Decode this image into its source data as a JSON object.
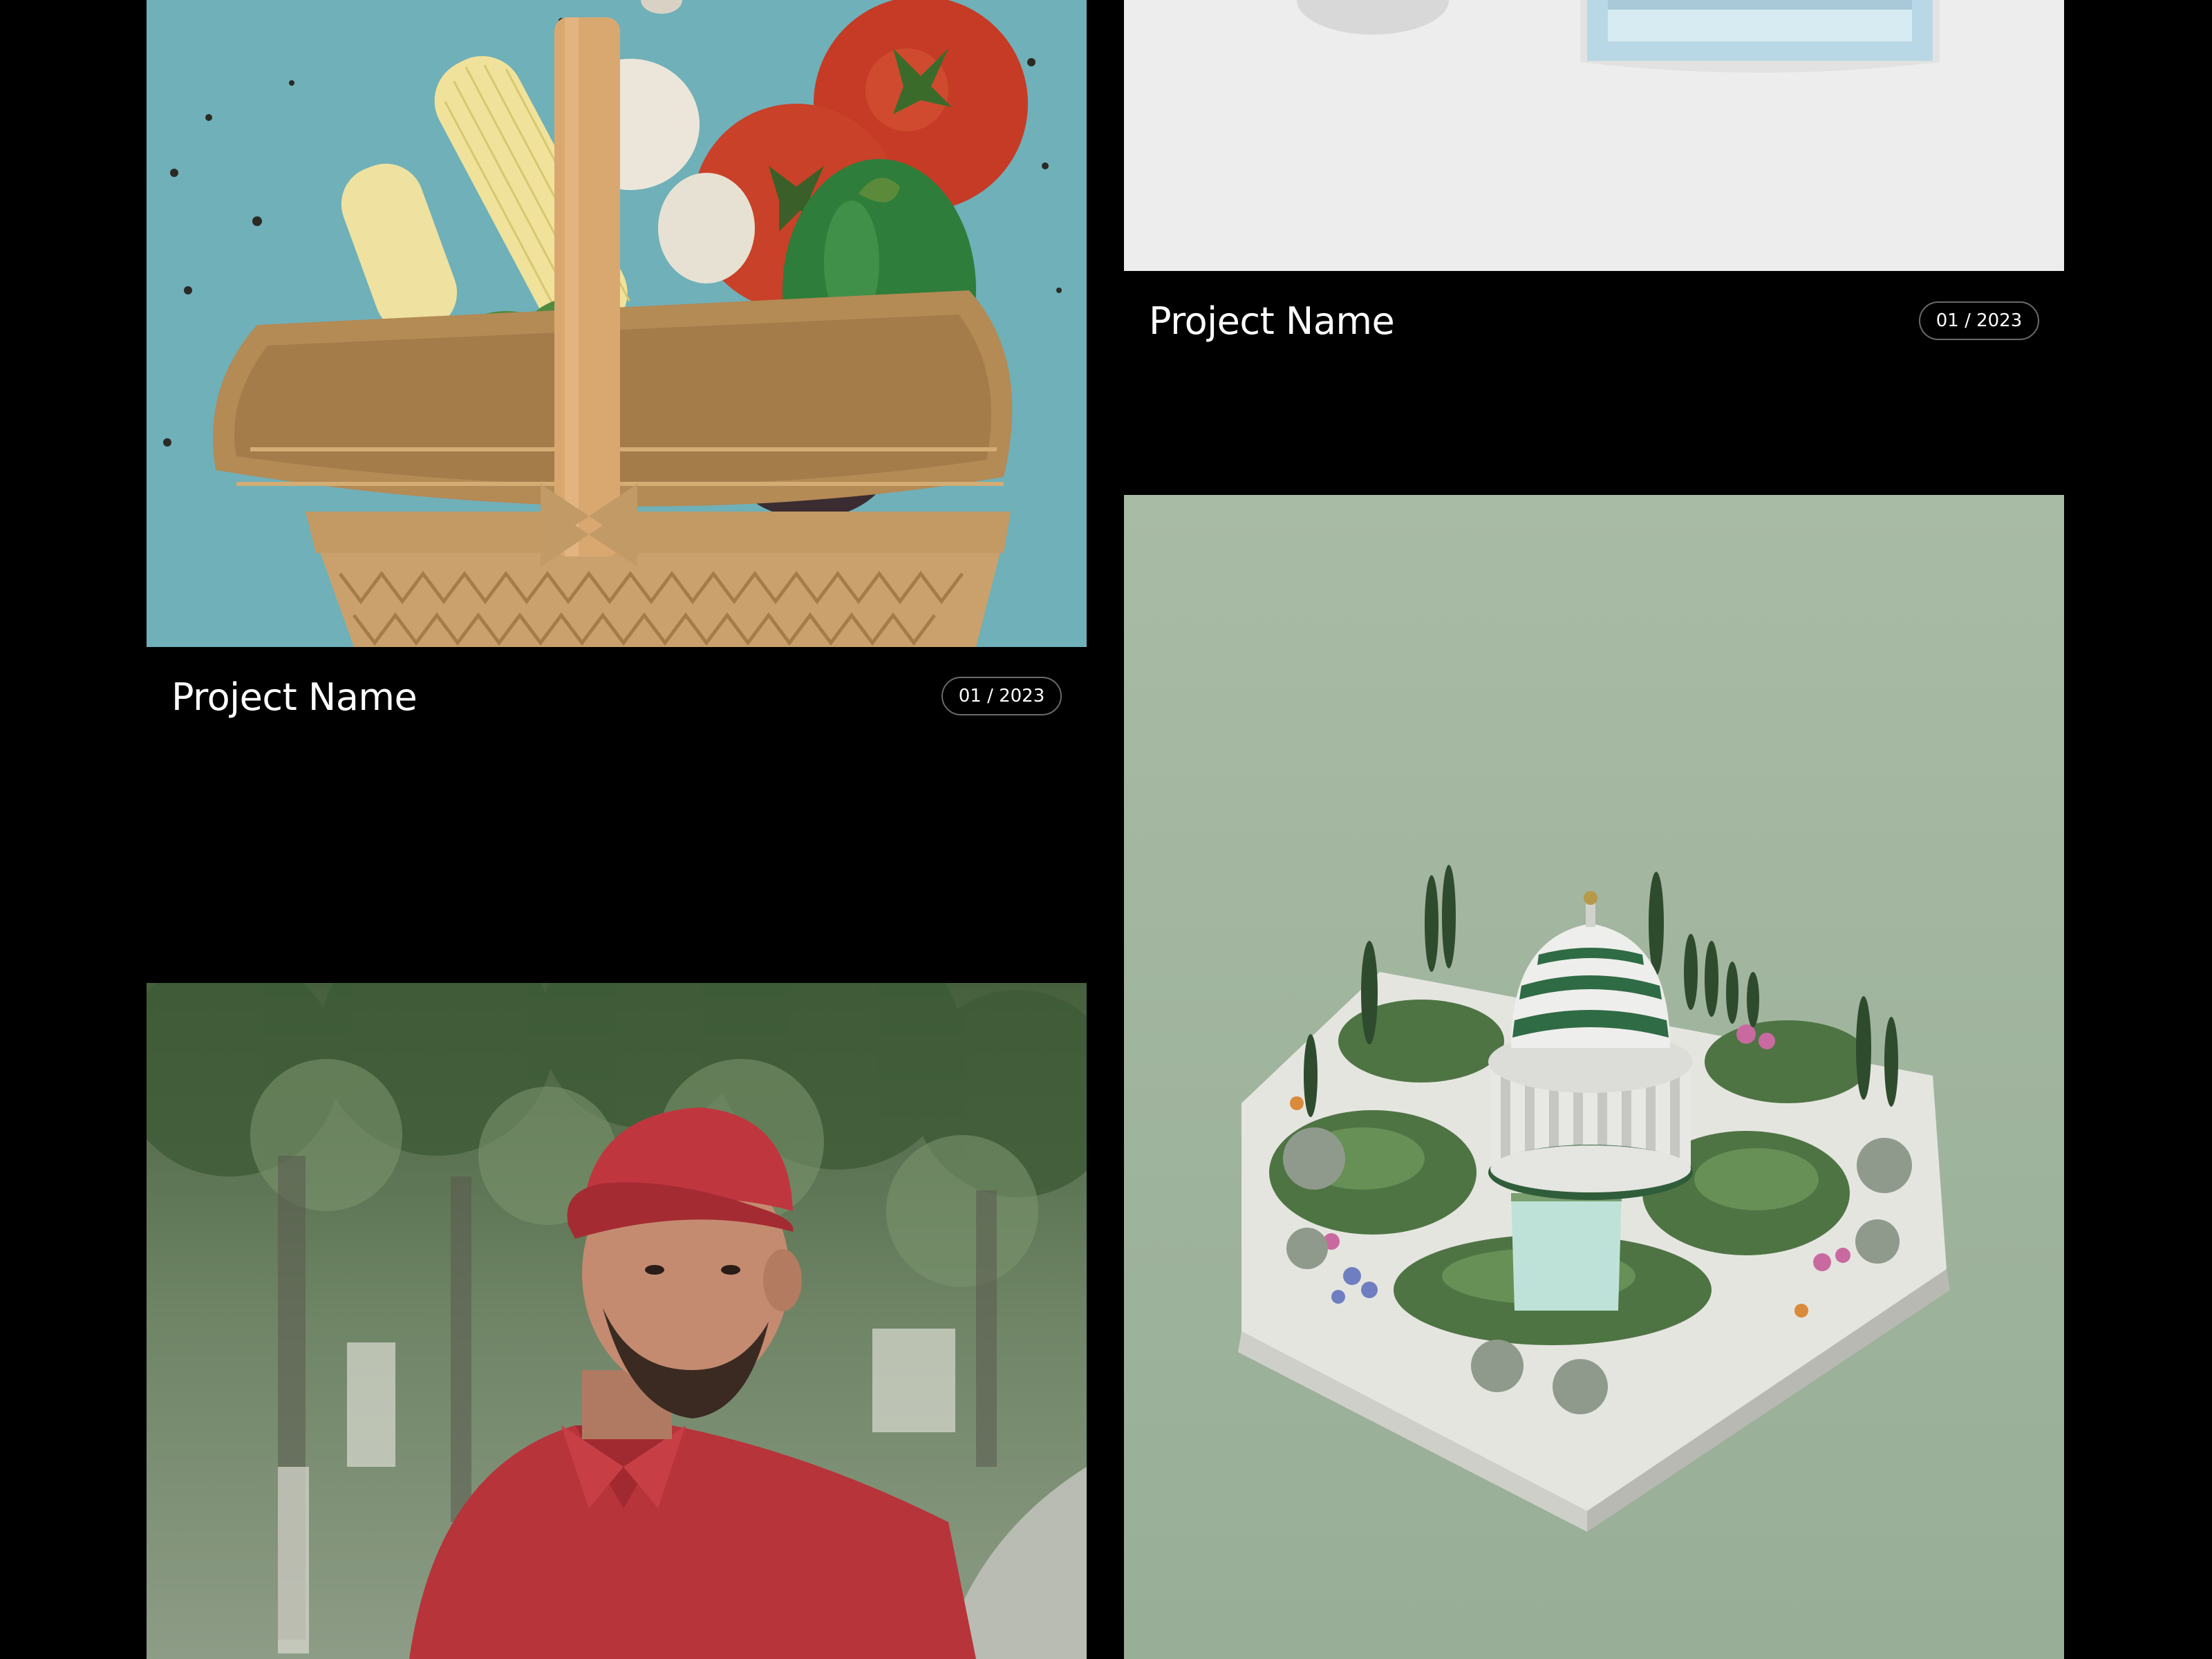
{
  "projects": [
    {
      "title": "Project Name",
      "date": "01 / 2023",
      "image": "vegetable-basket-photo"
    },
    {
      "title": "Project Name",
      "date": "01 / 2023",
      "image": "white-table-photo"
    },
    {
      "title": "",
      "date": "",
      "image": "isometric-garden-render"
    },
    {
      "title": "",
      "date": "",
      "image": "man-red-cap-photo"
    }
  ],
  "colors": {
    "background": "#000000",
    "text": "#ffffff",
    "badge_border": "#6a6a6a",
    "basket_bg": "#6fb0b9",
    "garden_bg": "#9cb39a"
  }
}
